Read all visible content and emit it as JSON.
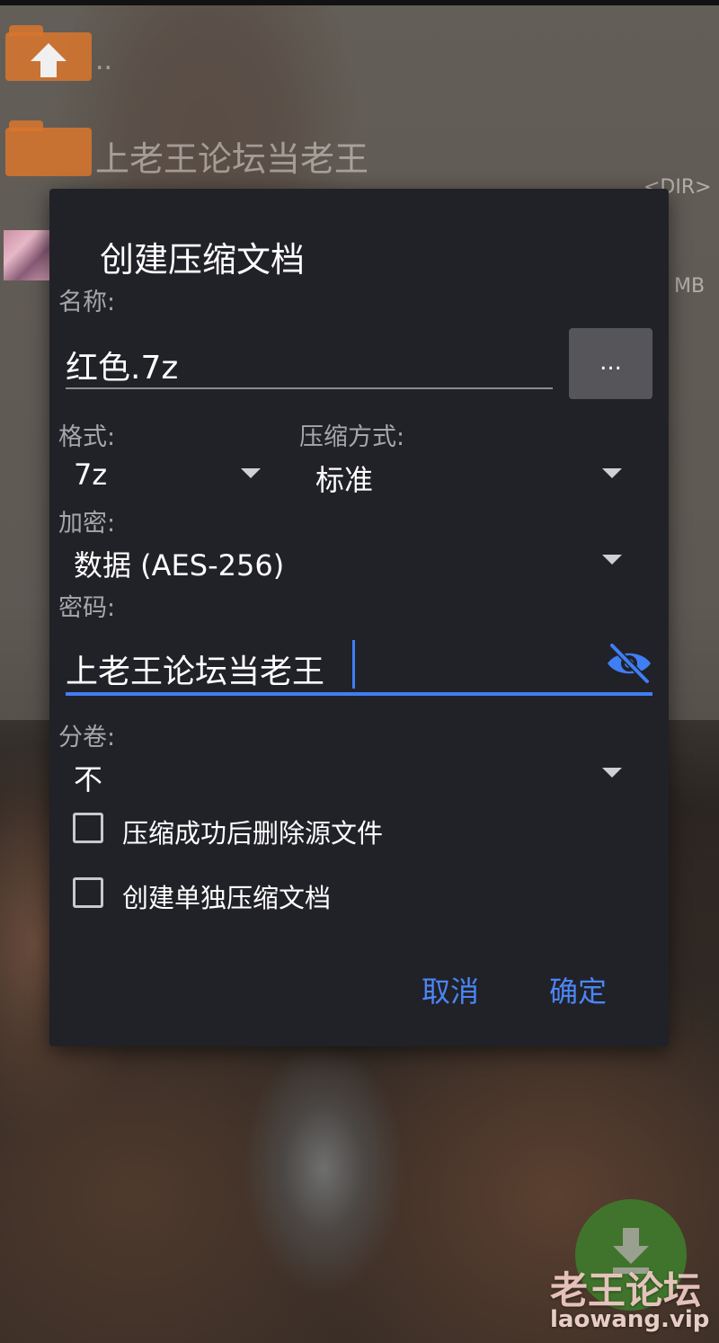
{
  "file_manager": {
    "parent_label": "..",
    "folder_name": "上老王论坛当老王",
    "folder_meta": "<DIR>",
    "file_meta": "MB"
  },
  "dialog": {
    "title": "创建压缩文档",
    "name_label": "名称:",
    "name_value": "红色.7z",
    "browse_label": "...",
    "format_label": "格式:",
    "format_value": "7z",
    "method_label": "压缩方式:",
    "method_value": "标准",
    "encrypt_label": "加密:",
    "encrypt_value": "数据 (AES-256)",
    "password_label": "密码:",
    "password_value": "上老王论坛当老王",
    "split_label": "分卷:",
    "split_value": "不",
    "checkboxes": [
      {
        "label": "压缩成功后删除源文件",
        "checked": false
      },
      {
        "label": "创建单独压缩文档",
        "checked": false
      }
    ],
    "cancel_label": "取消",
    "ok_label": "确定",
    "accent_color": "#4a86f5"
  },
  "watermark": {
    "title": "老王论坛",
    "url": "laowang.vip"
  },
  "icons": {
    "parent": "folder-up-icon",
    "folder": "folder-icon",
    "visibility": "eye-off-icon",
    "fab": "download-icon"
  }
}
